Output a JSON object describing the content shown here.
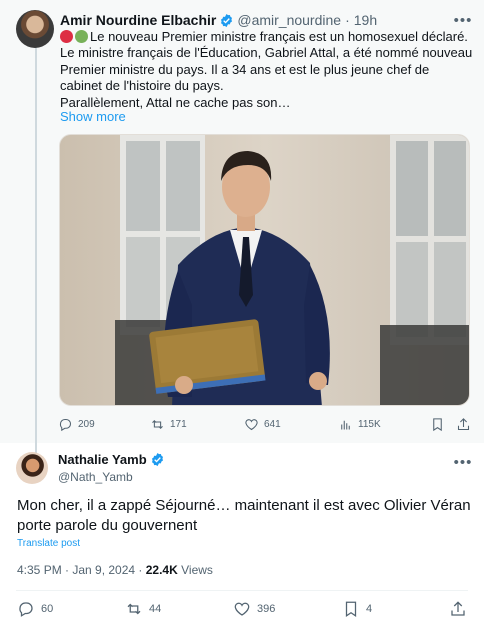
{
  "quoted_tweet": {
    "author_name": "Amir Nourdine Elbachir",
    "handle": "@amir_nourdine",
    "separator": "·",
    "time": "19h",
    "text_lines": [
      "Le nouveau Premier ministre français est un homosexuel déclaré.",
      "Le ministre français de l'Éducation, Gabriel Attal, a été nommé nouveau Premier ministre du pays. Il a 34 ans et est le plus jeune chef de cabinet de l'histoire du pays.",
      "Parallèlement, Attal ne cache pas son…"
    ],
    "leading_emojis": [
      "red-circle-emoji",
      "green-circle-emoji"
    ],
    "show_more": "Show more",
    "image_icon": "photo-man-in-suit-holding-folder",
    "stats": {
      "replies": "209",
      "reposts": "171",
      "likes": "641",
      "views": "115K"
    }
  },
  "main_tweet": {
    "author_name": "Nathalie Yamb",
    "handle": "@Nath_Yamb",
    "text": "Mon cher, il a zappé Séjourné… maintenant il est avec Olivier Véran porte parole du gouvernent",
    "translate": "Translate post",
    "timestamp": "4:35 PM · Jan 9, 2024 · ",
    "views_count": "22.4K",
    "views_label": " Views",
    "stats": {
      "replies": "60",
      "reposts": "44",
      "likes": "396",
      "bookmarks": "4"
    }
  },
  "colors": {
    "accent": "#1d9bf0",
    "secondary_text": "#536471",
    "quoted_background": "#f7f9f9",
    "thread_line": "#cfd9de"
  }
}
